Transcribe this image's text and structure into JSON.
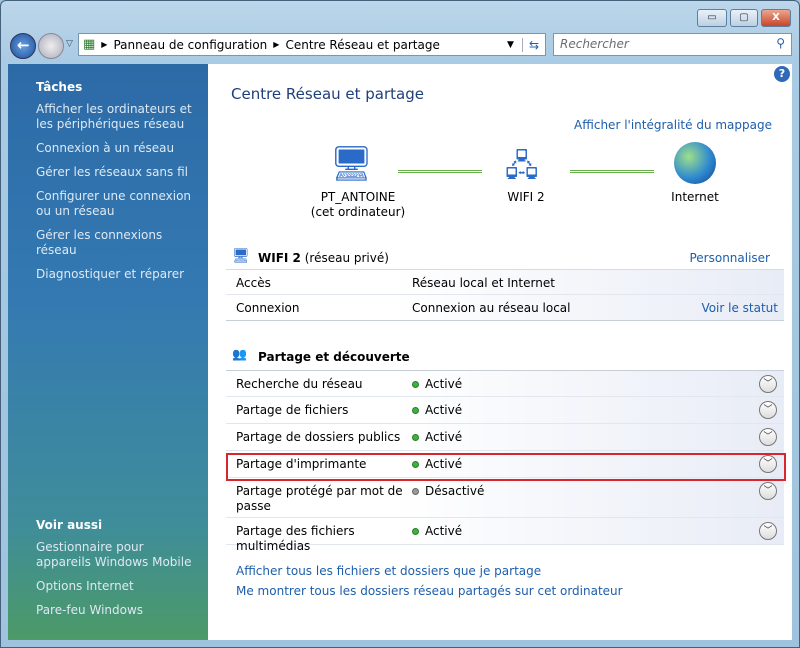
{
  "window": {
    "minimize": "▭",
    "maximize": "▢",
    "close": "X"
  },
  "address": {
    "crumbs": [
      "Panneau de configuration",
      "Centre Réseau et partage"
    ]
  },
  "search": {
    "placeholder": "Rechercher"
  },
  "sidebar": {
    "tasks_title": "Tâches",
    "tasks": [
      "Afficher les ordinateurs et les périphériques réseau",
      "Connexion à un réseau",
      "Gérer les réseaux sans fil",
      "Configurer une connexion ou un réseau",
      "Gérer les connexions réseau",
      "Diagnostiquer et réparer"
    ],
    "see_also_title": "Voir aussi",
    "see_also": [
      "Gestionnaire pour appareils Windows Mobile",
      "Options Internet",
      "Pare-feu Windows"
    ]
  },
  "main": {
    "title": "Centre Réseau et partage",
    "full_map": "Afficher l'intégralité du mappage",
    "map": {
      "computer": "PT_ANTOINE",
      "computer_sub": "(cet ordinateur)",
      "network": "WIFI 2",
      "internet": "Internet"
    },
    "network": {
      "name": "WIFI  2",
      "type": "(réseau privé)",
      "customize": "Personnaliser",
      "rows": [
        {
          "label": "Accès",
          "value": "Réseau local et Internet"
        },
        {
          "label": "Connexion",
          "value": "Connexion au réseau local",
          "link": "Voir le statut"
        }
      ]
    },
    "sharing": {
      "title": "Partage et découverte",
      "rows": [
        {
          "label": "Recherche du réseau",
          "status": "Activé",
          "on": true
        },
        {
          "label": "Partage de fichiers",
          "status": "Activé",
          "on": true
        },
        {
          "label": "Partage de dossiers publics",
          "status": "Activé",
          "on": true
        },
        {
          "label": "Partage d'imprimante",
          "status": "Activé",
          "on": true
        },
        {
          "label": "Partage protégé par mot de passe",
          "status": "Désactivé",
          "on": false
        },
        {
          "label": "Partage des fichiers multimédias",
          "status": "Activé",
          "on": true
        }
      ]
    },
    "links": [
      "Afficher tous les fichiers et dossiers que je partage",
      "Me montrer tous les dossiers réseau partagés sur cet ordinateur"
    ]
  },
  "colors": {
    "highlight": "#d9262c",
    "link": "#1d5eab"
  }
}
